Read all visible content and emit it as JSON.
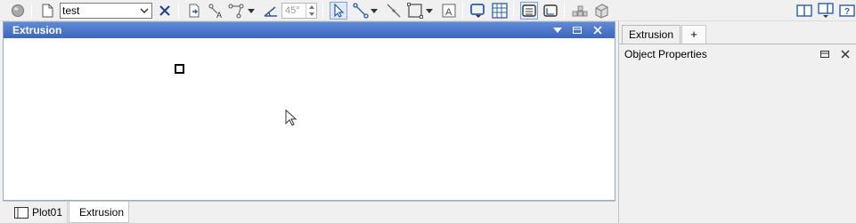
{
  "toolbar": {
    "combo_value": "test",
    "angle_value": "45°",
    "icons": [
      "ball-icon",
      "new-document-icon",
      "close-x-icon",
      "load-file-icon",
      "label-node-icon",
      "node-path-icon",
      "angle-icon",
      "select-arrow-icon",
      "connect-node-icon",
      "line-tool-icon",
      "rectangle-tool-icon",
      "text-frame-icon",
      "shape-dropdown-icon",
      "grid-icon",
      "table-view-icon",
      "chart-view-icon",
      "stack-icon",
      "extrude-cube-icon",
      "panel-layout-icon",
      "panel-menu-icon",
      "help-icon"
    ]
  },
  "panel": {
    "title": "Extrusion"
  },
  "bottom_tabs": [
    {
      "label": "Plot01",
      "active": false
    },
    {
      "label": "Extrusion",
      "active": true
    }
  ],
  "side": {
    "tab_label": "Extrusion",
    "add_tab_label": "+",
    "section_title": "Object Properties"
  },
  "colors": {
    "title_bar": "#4a76c9",
    "selected_tool": "#dfe9f7",
    "accent_blue": "#2a5caa"
  }
}
